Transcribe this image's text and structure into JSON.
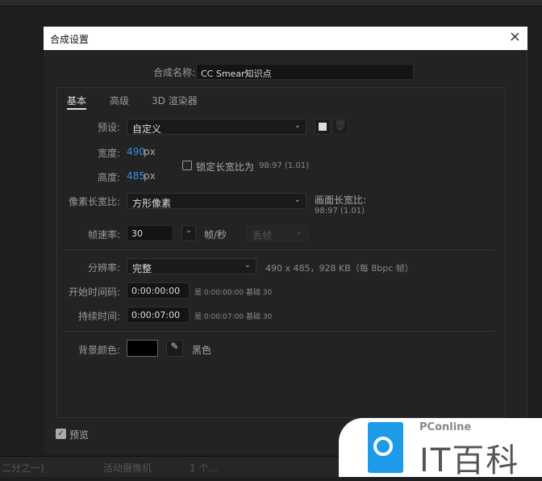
{
  "dialog": {
    "title": "合成设置",
    "close": "×"
  },
  "name": {
    "label": "合成名称:",
    "value": "CC Smear知识点"
  },
  "tabs": [
    {
      "label": "基本",
      "active": true
    },
    {
      "label": "高级"
    },
    {
      "label": "3D 渲染器"
    }
  ],
  "preset": {
    "label": "预设:",
    "value": "自定义"
  },
  "width": {
    "label": "宽度:",
    "value": "490",
    "unit": "px"
  },
  "height": {
    "label": "高度:",
    "value": "485",
    "unit": "px"
  },
  "lock_aspect": {
    "label": "锁定长宽比为",
    "value": "98:97 (1.01)",
    "checked": false
  },
  "pixel_aspect": {
    "label": "像素长宽比:",
    "value": "方形像素"
  },
  "frame_aspect": {
    "label": "画面长宽比:",
    "value": "98:97 (1.01)"
  },
  "frame_rate": {
    "label": "帧速率:",
    "value": "30",
    "unit": "帧/秒",
    "drop": "丢帧"
  },
  "resolution": {
    "label": "分辨率:",
    "value": "完整",
    "info": "490 x 485，928 KB（每 8bpc 帧）"
  },
  "start_tc": {
    "label": "开始时间码:",
    "value": "0:00:00:00",
    "info": "是 0:00:00:00  基础 30"
  },
  "duration": {
    "label": "持续时间:",
    "value": "0:00:07:00",
    "info": "是 0:00:07:00  基础 30"
  },
  "bg": {
    "label": "背景颜色:",
    "name": "黑色",
    "color": "#000000"
  },
  "preview": {
    "label": "预览",
    "checked": true
  },
  "bottombar": {
    "zoom": "二分之一)",
    "camera": "活动摄像机",
    "views": "1 个..."
  },
  "watermark": {
    "brand": "PConline",
    "name": "IT百科",
    "color": "#1e9be8"
  }
}
